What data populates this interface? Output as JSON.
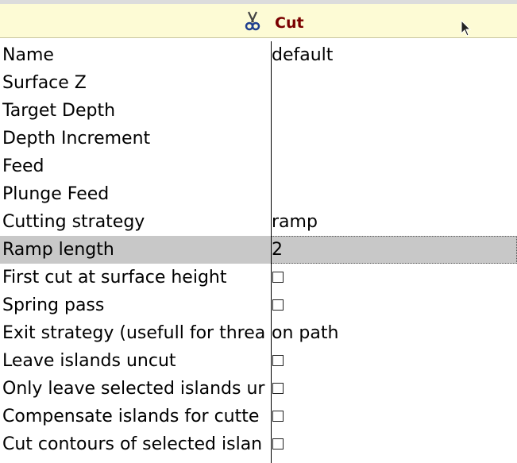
{
  "header": {
    "title": "Cut",
    "icon": "scissors-icon"
  },
  "rows": [
    {
      "label": "Name",
      "value": "default",
      "type": "text"
    },
    {
      "label": "Surface Z",
      "value": "",
      "type": "text"
    },
    {
      "label": "Target Depth",
      "value": "",
      "type": "text"
    },
    {
      "label": "Depth Increment",
      "value": "",
      "type": "text"
    },
    {
      "label": "Feed",
      "value": "",
      "type": "text"
    },
    {
      "label": "Plunge Feed",
      "value": "",
      "type": "text"
    },
    {
      "label": "Cutting strategy",
      "value": "ramp",
      "type": "text"
    },
    {
      "label": "Ramp length",
      "value": "2",
      "type": "text",
      "selected": true
    },
    {
      "label": "First cut at surface height",
      "checked": false,
      "type": "checkbox"
    },
    {
      "label": "Spring pass",
      "checked": false,
      "type": "checkbox"
    },
    {
      "label": "Exit strategy (usefull for threa",
      "value": "on path",
      "type": "text"
    },
    {
      "label": "Leave islands uncut",
      "checked": false,
      "type": "checkbox"
    },
    {
      "label": "Only leave selected islands ur",
      "checked": false,
      "type": "checkbox"
    },
    {
      "label": "Compensate islands for cutte",
      "checked": false,
      "type": "checkbox"
    },
    {
      "label": "Cut contours of selected islan",
      "checked": false,
      "type": "checkbox"
    }
  ]
}
